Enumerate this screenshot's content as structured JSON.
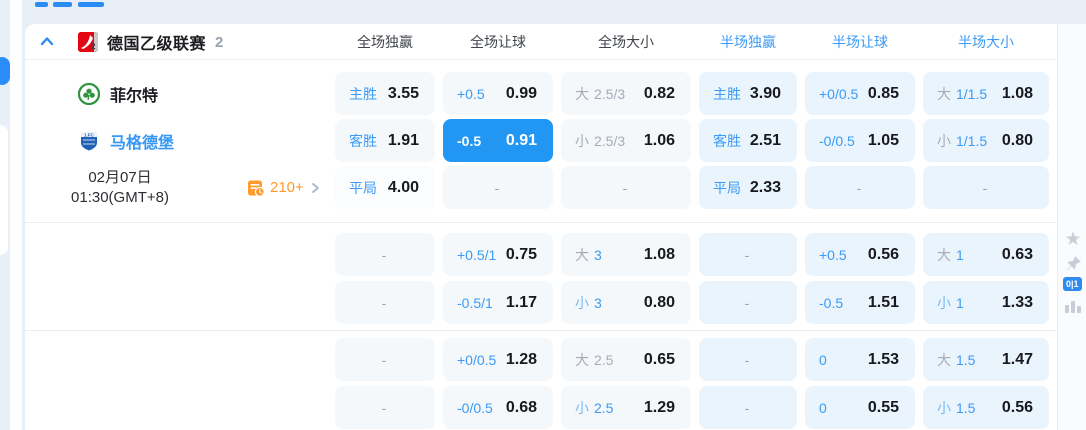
{
  "colors": {
    "accent": "#3b9bf5",
    "highlight": "#2196f3",
    "orange": "#ff9a2e",
    "grey": "#a5acb8"
  },
  "header": {
    "league": "德国乙级联赛",
    "match_count": "2",
    "columns": [
      {
        "label": "全场独赢",
        "half": false
      },
      {
        "label": "全场让球",
        "half": false
      },
      {
        "label": "全场大小",
        "half": false
      },
      {
        "label": "半场独赢",
        "half": true
      },
      {
        "label": "半场让球",
        "half": true
      },
      {
        "label": "半场大小",
        "half": true
      }
    ]
  },
  "match": {
    "home_team": "菲尔特",
    "away_team": "马格德堡",
    "date": "02月07日",
    "time": "01:30(GMT+8)",
    "more_odds_count": "210+"
  },
  "gutter": {
    "badge": "0|1"
  },
  "icons": {
    "collapse": "chevron-up",
    "pin": "pushpin",
    "star": "★",
    "stats": "bar-chart",
    "more": "list-clock",
    "arrow": "chevron-right"
  },
  "blocks": [
    {
      "rows": [
        {
          "cells": [
            {
              "l": "主胜",
              "lc": "blue",
              "v": "3.55",
              "bg": "full"
            },
            {
              "l": "+0.5",
              "lc": "blue",
              "v": "0.99",
              "bg": "full"
            },
            {
              "l": "大",
              "lc": "grey",
              "h": "2.5/3",
              "hc": "grey",
              "v": "0.82",
              "bg": "full"
            },
            {
              "l": "主胜",
              "lc": "blue",
              "v": "3.90",
              "bg": "half"
            },
            {
              "l": "+0/0.5",
              "lc": "blue",
              "v": "0.85",
              "bg": "half"
            },
            {
              "l": "大",
              "lc": "grey",
              "h": "1/1.5",
              "hc": "blue",
              "v": "1.08",
              "bg": "half"
            }
          ]
        },
        {
          "cells": [
            {
              "l": "客胜",
              "lc": "blue",
              "v": "1.91",
              "bg": "full"
            },
            {
              "l": "-0.5",
              "lc": "white",
              "v": "0.91",
              "bg": "hl"
            },
            {
              "l": "小",
              "lc": "grey",
              "h": "2.5/3",
              "hc": "grey",
              "v": "1.06",
              "bg": "full"
            },
            {
              "l": "客胜",
              "lc": "blue",
              "v": "2.51",
              "bg": "half"
            },
            {
              "l": "-0/0.5",
              "lc": "blue",
              "v": "1.05",
              "bg": "half"
            },
            {
              "l": "小",
              "lc": "grey",
              "h": "1/1.5",
              "hc": "blue",
              "v": "0.80",
              "bg": "half"
            }
          ]
        },
        {
          "cells": [
            {
              "l": "平局",
              "lc": "blue",
              "v": "4.00",
              "bg": "draw"
            },
            {
              "dash": true,
              "bg": "full"
            },
            {
              "dash": true,
              "bg": "full"
            },
            {
              "l": "平局",
              "lc": "blue",
              "v": "2.33",
              "bg": "half"
            },
            {
              "dash": true,
              "bg": "half"
            },
            {
              "dash": true,
              "bg": "half"
            }
          ]
        }
      ]
    },
    {
      "rows": [
        {
          "cells": [
            {
              "dash": true,
              "bg": "full"
            },
            {
              "l": "+0.5/1",
              "lc": "blue",
              "v": "0.75",
              "bg": "full"
            },
            {
              "l": "大",
              "lc": "grey",
              "h": "3",
              "hc": "blue",
              "v": "1.08",
              "bg": "full"
            },
            {
              "dash": true,
              "bg": "half"
            },
            {
              "l": "+0.5",
              "lc": "blue",
              "v": "0.56",
              "bg": "half"
            },
            {
              "l": "大",
              "lc": "grey",
              "h": "1",
              "hc": "blue",
              "v": "0.63",
              "bg": "half"
            }
          ]
        },
        {
          "cells": [
            {
              "dash": true,
              "bg": "full"
            },
            {
              "l": "-0.5/1",
              "lc": "blue",
              "v": "1.17",
              "bg": "full"
            },
            {
              "l": "小",
              "lc": "lblue",
              "h": "3",
              "hc": "blue",
              "v": "0.80",
              "bg": "full"
            },
            {
              "dash": true,
              "bg": "half"
            },
            {
              "l": "-0.5",
              "lc": "blue",
              "v": "1.51",
              "bg": "half"
            },
            {
              "l": "小",
              "lc": "lblue",
              "h": "1",
              "hc": "blue",
              "v": "1.33",
              "bg": "half"
            }
          ]
        }
      ]
    },
    {
      "rows": [
        {
          "cells": [
            {
              "dash": true,
              "bg": "full"
            },
            {
              "l": "+0/0.5",
              "lc": "blue",
              "v": "1.28",
              "bg": "full"
            },
            {
              "l": "大",
              "lc": "grey",
              "h": "2.5",
              "hc": "grey",
              "v": "0.65",
              "bg": "full"
            },
            {
              "dash": true,
              "bg": "half"
            },
            {
              "l": "0",
              "lc": "blue",
              "v": "1.53",
              "bg": "half"
            },
            {
              "l": "大",
              "lc": "grey",
              "h": "1.5",
              "hc": "blue",
              "v": "1.47",
              "bg": "half"
            }
          ]
        },
        {
          "cells": [
            {
              "dash": true,
              "bg": "full"
            },
            {
              "l": "-0/0.5",
              "lc": "blue",
              "v": "0.68",
              "bg": "full"
            },
            {
              "l": "小",
              "lc": "lblue",
              "h": "2.5",
              "hc": "blue",
              "v": "1.29",
              "bg": "full"
            },
            {
              "dash": true,
              "bg": "half"
            },
            {
              "l": "0",
              "lc": "blue",
              "v": "0.55",
              "bg": "half"
            },
            {
              "l": "小",
              "lc": "lblue",
              "h": "1.5",
              "hc": "blue",
              "v": "0.56",
              "bg": "half"
            }
          ]
        }
      ]
    }
  ]
}
